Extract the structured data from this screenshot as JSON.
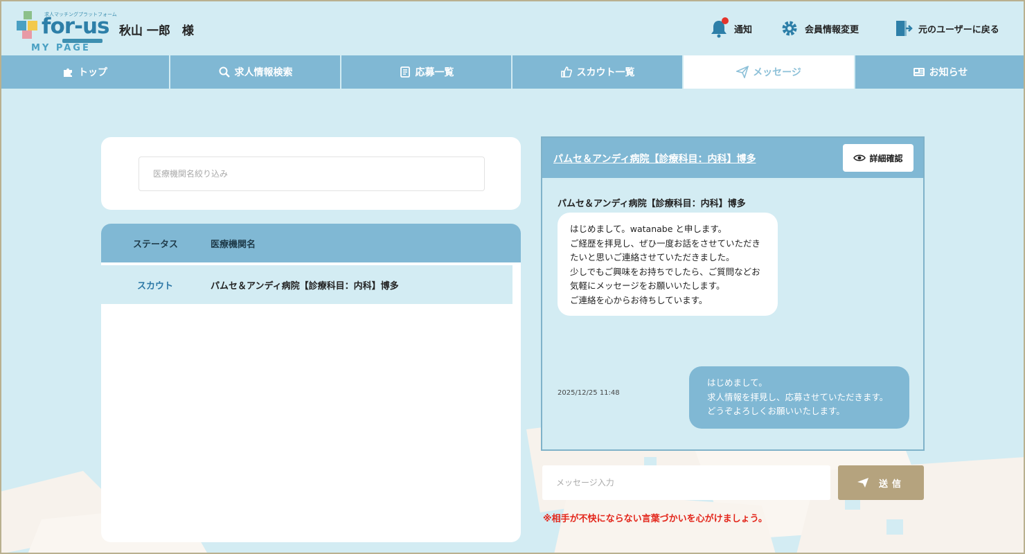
{
  "header": {
    "logo_tagline": "求人マッチングプラットフォーム",
    "logo_text": "for-us",
    "logo_sub": "MY PAGE",
    "user_name": "秋山 一郎　様",
    "actions": [
      {
        "label": "通知",
        "icon": "bell-icon"
      },
      {
        "label": "会員情報変更",
        "icon": "gear-icon"
      },
      {
        "label": "元のユーザーに戻る",
        "icon": "exit-door-icon"
      }
    ]
  },
  "nav": {
    "items": [
      {
        "label": "トップ",
        "icon": "puzzle-icon"
      },
      {
        "label": "求人情報検索",
        "icon": "search-icon"
      },
      {
        "label": "応募一覧",
        "icon": "document-icon"
      },
      {
        "label": "スカウト一覧",
        "icon": "thumbs-up-icon"
      },
      {
        "label": "メッセージ",
        "icon": "paper-plane-icon",
        "active": true
      },
      {
        "label": "お知らせ",
        "icon": "newspaper-icon"
      }
    ]
  },
  "search": {
    "placeholder": "医療機関名絞り込み"
  },
  "list": {
    "headers": {
      "status": "ステータス",
      "name": "医療機関名"
    },
    "rows": [
      {
        "status": "スカウト",
        "name": "パムセ＆アンディ病院【診療科目：内科】博多"
      }
    ]
  },
  "chat": {
    "title": "パムセ＆アンディ病院【診療科目：内科】博多",
    "detail_button": "詳細確認",
    "sender_name": "パムセ＆アンディ病院【診療科目：内科】博多",
    "incoming_message": "はじめまして。watanabe と申します。\nご経歴を拝見し、ぜひ一度お話をさせていただきたいと思いご連絡させていただきました。\n少しでもご興味をお持ちでしたら、ご質問などお気軽にメッセージをお願いいたします。\nご連絡を心からお待ちしています。",
    "incoming_time": "2025/12/25 11:48",
    "outgoing_message": "はじめまして。\n求人情報を拝見し、応募させていただきます。\nどうぞよろしくお願いいたします。"
  },
  "composer": {
    "placeholder": "メッセージ入力",
    "send_label": "送信",
    "note": "※相手が不快にならない言葉づかいを心がけましょう。"
  },
  "colors": {
    "background": "#d3ecf3",
    "nav": "#80b8d4",
    "accent_blue": "#2d7fa8",
    "send_button": "#b5a37e",
    "warning": "#e3261b",
    "notification_dot": "#e4342b"
  }
}
